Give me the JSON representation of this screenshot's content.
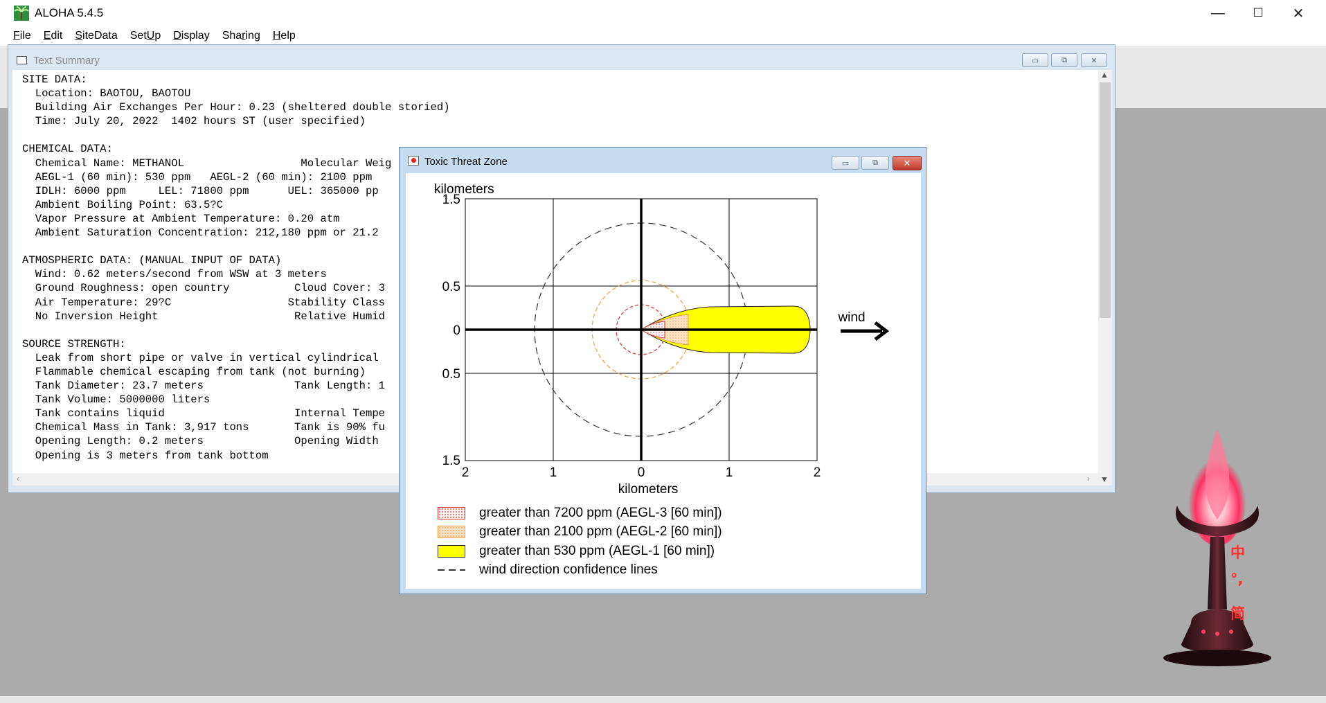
{
  "app": {
    "title": "ALOHA 5.4.5"
  },
  "window_controls": {
    "minimize": "—",
    "maximize": "☐",
    "close": "✕"
  },
  "menu": {
    "file": {
      "ul": "F",
      "rest": "ile"
    },
    "edit": {
      "ul": "E",
      "rest": "dit"
    },
    "sitedata": {
      "ul": "S",
      "rest": "iteData"
    },
    "setup": {
      "pre": "Set",
      "ul": "U",
      "rest": "p"
    },
    "display": {
      "ul": "D",
      "rest": "isplay"
    },
    "sharing": {
      "pre": "Sha",
      "ul": "r",
      "rest": "ing"
    },
    "help": {
      "ul": "H",
      "rest": "elp"
    }
  },
  "text_summary": {
    "title": "Text Summary",
    "content": "SITE DATA:\n  Location: BAOTOU, BAOTOU\n  Building Air Exchanges Per Hour: 0.23 (sheltered double storied)\n  Time: July 20, 2022  1402 hours ST (user specified)\n\nCHEMICAL DATA:\n  Chemical Name: METHANOL                  Molecular Weig\n  AEGL-1 (60 min): 530 ppm   AEGL-2 (60 min): 2100 ppm\n  IDLH: 6000 ppm     LEL: 71800 ppm      UEL: 365000 pp\n  Ambient Boiling Point: 63.5?C\n  Vapor Pressure at Ambient Temperature: 0.20 atm\n  Ambient Saturation Concentration: 212,180 ppm or 21.2\n\nATMOSPHERIC DATA: (MANUAL INPUT OF DATA)\n  Wind: 0.62 meters/second from WSW at 3 meters\n  Ground Roughness: open country          Cloud Cover: 3\n  Air Temperature: 29?C                  Stability Class\n  No Inversion Height                     Relative Humid\n\nSOURCE STRENGTH:\n  Leak from short pipe or valve in vertical cylindrical\n  Flammable chemical escaping from tank (not burning)\n  Tank Diameter: 23.7 meters              Tank Length: 1\n  Tank Volume: 5000000 liters\n  Tank contains liquid                    Internal Tempe\n  Chemical Mass in Tank: 3,917 tons       Tank is 90% fu\n  Opening Length: 0.2 meters              Opening Width\n  Opening is 3 meters from tank bottom"
  },
  "threat_zone": {
    "title": "Toxic Threat Zone",
    "y_axis_label": "kilometers",
    "x_axis_label": "kilometers",
    "y_ticks": [
      "1.5",
      "0.5",
      "0",
      "0.5",
      "1.5"
    ],
    "x_ticks": [
      "2",
      "1",
      "0",
      "1",
      "2"
    ],
    "wind_label": "wind",
    "legend": [
      {
        "label": "greater than 7200 ppm (AEGL-3 [60 min])",
        "color": "#e03030"
      },
      {
        "label": "greater than 2100 ppm (AEGL-2 [60 min])",
        "color": "#f0a040"
      },
      {
        "label": "greater than 530 ppm (AEGL-1 [60 min])",
        "color": "#ffff00"
      },
      {
        "label": "wind direction confidence lines",
        "color": "#333333"
      }
    ]
  },
  "ime": {
    "chars": [
      "中",
      "°,",
      "简"
    ]
  }
}
